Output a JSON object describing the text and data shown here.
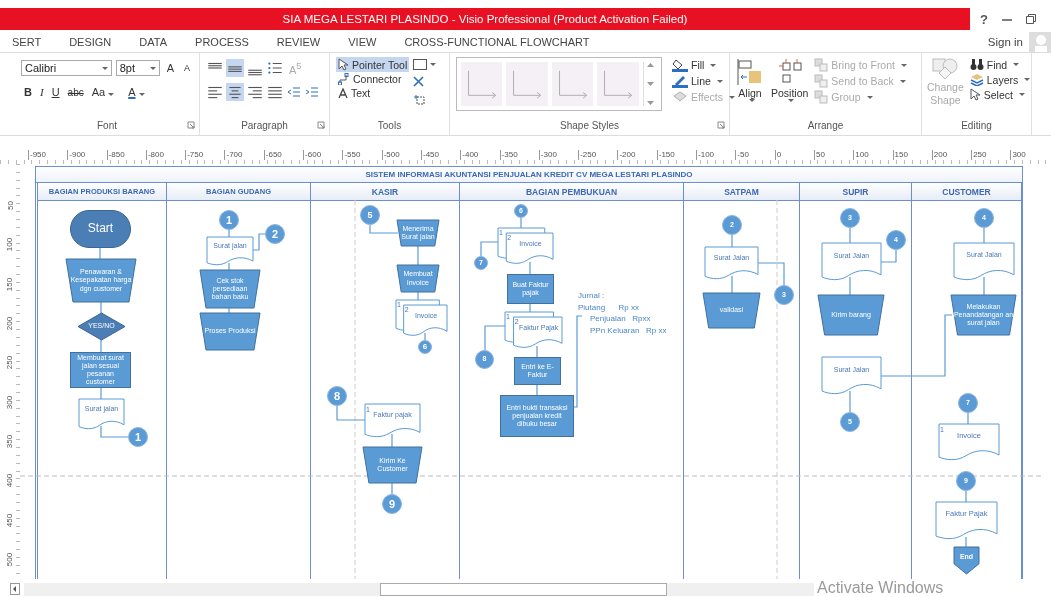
{
  "window": {
    "title": "SIA MEGA LESTARI PLASINDO -  Visio Professional (Product Activation Failed)",
    "help": "?"
  },
  "tabs": [
    {
      "label": "SERT",
      "selected": false
    },
    {
      "label": "DESIGN",
      "selected": false
    },
    {
      "label": "DATA",
      "selected": false
    },
    {
      "label": "PROCESS",
      "selected": false
    },
    {
      "label": "REVIEW",
      "selected": false
    },
    {
      "label": "VIEW",
      "selected": false
    },
    {
      "label": "CROSS-FUNCTIONAL FLOWCHART",
      "selected": false
    }
  ],
  "account": {
    "label": "Sign in"
  },
  "ribbon": {
    "font": {
      "label": "Font",
      "font_name": "Calibri",
      "font_size": "8pt",
      "grow": "A",
      "shrink": "A",
      "styles": [
        "B",
        "I",
        "U",
        "abc"
      ],
      "case": "Aa",
      "color_button": "A"
    },
    "paragraph": {
      "label": "Paragraph",
      "vertical_align": [
        {
          "selected": false
        },
        {
          "selected": true
        },
        {
          "selected": false
        }
      ],
      "horizontal_align": [
        {
          "selected": false
        },
        {
          "selected": true
        },
        {
          "selected": false
        },
        {
          "selected": false
        }
      ],
      "text_block": "A$^{5}$"
    },
    "tools": {
      "label": "Tools",
      "items": [
        {
          "label": "Pointer Tool",
          "selected": true
        },
        {
          "label": "Connector",
          "selected": false
        },
        {
          "label": "Text",
          "selected": false
        }
      ]
    },
    "shape_styles": {
      "label": "Shape Styles",
      "commands": [
        {
          "label": "Fill",
          "disabled": false
        },
        {
          "label": "Line",
          "disabled": false
        },
        {
          "label": "Effects",
          "disabled": true
        }
      ]
    },
    "arrange": {
      "label": "Arrange",
      "big": [
        {
          "label": "Align"
        },
        {
          "label": "Position"
        }
      ],
      "commands": [
        {
          "label": "Bring to Front",
          "disabled": true
        },
        {
          "label": "Send to Back",
          "disabled": true
        },
        {
          "label": "Group",
          "disabled": true
        }
      ]
    },
    "editing": {
      "label": "Editing",
      "change_shape": {
        "label": "Change Shape",
        "disabled": true
      },
      "commands": [
        {
          "label": "Find",
          "disabled": false
        },
        {
          "label": "Layers",
          "disabled": false
        },
        {
          "label": "Select",
          "disabled": false
        }
      ]
    }
  },
  "rulers": {
    "horizontal": [
      "-950",
      "-900",
      "-850",
      "-800",
      "-750",
      "-700",
      "-650",
      "-600",
      "-550",
      "-500",
      "-450",
      "-400",
      "-350",
      "-300",
      "-250",
      "-200",
      "-150",
      "-100",
      "-50",
      "0",
      "50",
      "100",
      "150",
      "200",
      "250",
      "300"
    ],
    "vertical": [
      "50",
      "100",
      "150",
      "200",
      "250",
      "300",
      "350",
      "400",
      "450",
      "500"
    ]
  },
  "diagram": {
    "title": "SISTEM INFORMASI AKUNTANSI PENJUALAN KREDIT CV MEGA LESTARI PLASINDO",
    "lanes": [
      {
        "name": "BAGIAN PRODUKSI BARANG",
        "nodes": [
          {
            "kind": "terminator",
            "text": "Start"
          },
          {
            "kind": "manual",
            "text": "Penawaran & Kesepakatan harga dgn customer"
          },
          {
            "kind": "decision",
            "text": "YES/NO"
          },
          {
            "kind": "process",
            "text": "Membuat surat jalan sesuai pesanan customer"
          },
          {
            "kind": "document",
            "text": "Surat jalan"
          },
          {
            "kind": "connector",
            "text": "1"
          }
        ]
      },
      {
        "name": "BAGIAN GUDANG",
        "nodes": [
          {
            "kind": "connector",
            "text": "1"
          },
          {
            "kind": "document",
            "text": "Surat jalan"
          },
          {
            "kind": "connector",
            "text": "2"
          },
          {
            "kind": "manual",
            "text": "Cek stok persediaan bahan baku"
          },
          {
            "kind": "manual",
            "text": "Proses Produksi"
          }
        ]
      },
      {
        "name": "KASIR",
        "nodes": [
          {
            "kind": "connector",
            "text": "5"
          },
          {
            "kind": "manual",
            "text": "Menerima Surat jalan"
          },
          {
            "kind": "manual",
            "text": "Membuat invoice"
          },
          {
            "kind": "multidocument",
            "text": "Invoice",
            "copies": [
              "1",
              "2"
            ]
          },
          {
            "kind": "connector",
            "text": "6"
          },
          {
            "kind": "connector",
            "text": "8"
          },
          {
            "kind": "document",
            "text": "Faktur pajak",
            "copies": [
              "1"
            ]
          },
          {
            "kind": "manual",
            "text": "Kirim Ke Customer"
          },
          {
            "kind": "connector",
            "text": "9"
          }
        ]
      },
      {
        "name": "BAGIAN PEMBUKUAN",
        "nodes": [
          {
            "kind": "connector",
            "text": "6"
          },
          {
            "kind": "multidocument",
            "text": "Invoice",
            "copies": [
              "1",
              "2"
            ]
          },
          {
            "kind": "connector",
            "text": "7"
          },
          {
            "kind": "process",
            "text": "Buat Faktur pajak"
          },
          {
            "kind": "multidocument",
            "text": "Faktur Pajak",
            "copies": [
              "1",
              "2"
            ]
          },
          {
            "kind": "connector",
            "text": "8"
          },
          {
            "kind": "process",
            "text": "Entri ke E-Faktur"
          },
          {
            "kind": "process",
            "text": "Entri bukti transaksi penjualan kredit dibuku besar"
          },
          {
            "kind": "note",
            "lines": [
              {
                "kind": "heading",
                "text": "Jurnal :"
              },
              {
                "kind": "debit",
                "text": "Piutang      Rp xx"
              },
              {
                "kind": "credit",
                "text": "Penjualan   Rpxx"
              },
              {
                "kind": "credit",
                "text": "PPn Keluaran   Rp xx"
              }
            ]
          }
        ]
      },
      {
        "name": "SATPAM",
        "nodes": [
          {
            "kind": "connector",
            "text": "2"
          },
          {
            "kind": "document",
            "text": "Surat Jalan"
          },
          {
            "kind": "manual",
            "text": "validasi"
          },
          {
            "kind": "connector",
            "text": "3"
          }
        ]
      },
      {
        "name": "SUPIR",
        "nodes": [
          {
            "kind": "connector",
            "text": "3"
          },
          {
            "kind": "document",
            "text": "Surat Jalan"
          },
          {
            "kind": "connector",
            "text": "4"
          },
          {
            "kind": "manual",
            "text": "Kirim barang"
          },
          {
            "kind": "document",
            "text": "Surat Jalan"
          },
          {
            "kind": "connector",
            "text": "5"
          }
        ]
      },
      {
        "name": "CUSTOMER",
        "nodes": [
          {
            "kind": "connector",
            "text": "4"
          },
          {
            "kind": "document",
            "text": "Surat Jalan"
          },
          {
            "kind": "manual",
            "text": "Melakukan Penandatangan an surat jalan"
          },
          {
            "kind": "connector",
            "text": "7"
          },
          {
            "kind": "document",
            "text": "Invoice",
            "copies": [
              "1"
            ]
          },
          {
            "kind": "connector",
            "text": "9"
          },
          {
            "kind": "document",
            "text": "Faktur Pajak"
          },
          {
            "kind": "offpage",
            "text": "End"
          }
        ]
      }
    ]
  },
  "notice": "Activate Windows"
}
